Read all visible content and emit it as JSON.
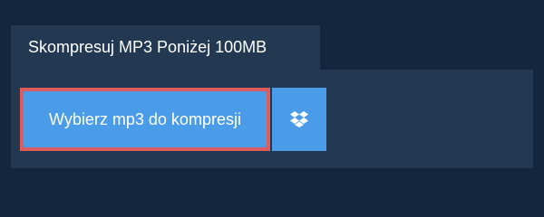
{
  "tab": {
    "title": "Skompresuj MP3 Poniżej 100MB"
  },
  "upload": {
    "button_label": "Wybierz mp3 do kompresji",
    "icon": "dropbox-icon"
  },
  "colors": {
    "background": "#14263d",
    "panel": "#233952",
    "button": "#4a9be8",
    "highlight_border": "#e05b5b"
  }
}
